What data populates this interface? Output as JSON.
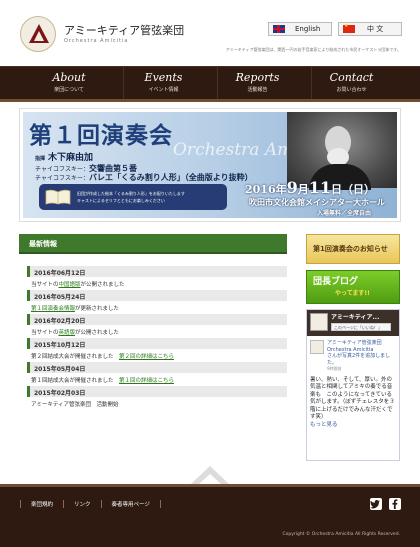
{
  "header": {
    "site_name": "アミーキティア管弦楽団",
    "site_sub": "Orchestra Amicitia",
    "tagline": "アミーキティア管弦楽団は、関西一円の若手音楽家により結成された市民オーケストラ団体です。",
    "lang_en": "English",
    "lang_zh": "中 文"
  },
  "nav": [
    {
      "en": "About",
      "ja": "楽団について"
    },
    {
      "en": "Events",
      "ja": "イベント情報"
    },
    {
      "en": "Reports",
      "ja": "活動報告"
    },
    {
      "en": "Contact",
      "ja": "お問い合わせ"
    }
  ],
  "hero": {
    "title": "第１回演奏会",
    "script": "Orchestra Amicitia",
    "conductor_role": "指揮",
    "conductor_name": "木下麻由加",
    "program1_composer": "チャイコフスキー：",
    "program1_work": "交響曲第５番",
    "program2_composer": "チャイコフスキー：",
    "program2_work": "バレエ「くるみ割り人形」（全曲版より抜粋）",
    "box_line1": "旧団が作成した絵本「くるみ割り人形」をお配りいたします",
    "box_line2": "キャストによるセリフとともにお楽しみください",
    "date_year": "2016年",
    "date_month": "9",
    "date_month_suffix": "月",
    "date_day": "11",
    "date_day_suffix": "日",
    "date_weekday": "（日）",
    "venue": "吹田市文化会館メイシアター大ホール",
    "admission": "入場無料／全席自由"
  },
  "news": {
    "heading": "最新情報",
    "items": [
      {
        "date": "2016年06月12日",
        "pre": "当サイトの",
        "link": "中国語版",
        "post": "が公開されました"
      },
      {
        "date": "2016年05月24日",
        "pre": "",
        "link": "第１回演奏会情報",
        "post": "が更新されました"
      },
      {
        "date": "2016年02月20日",
        "pre": "当サイトの",
        "link": "英語版",
        "post": "が公開されました"
      },
      {
        "date": "2015年10月12日",
        "pre": "第２回結成大会が開催されました　",
        "link": "第２回の詳細はこちら",
        "post": ""
      },
      {
        "date": "2015年05月04日",
        "pre": "第１回結成大会が開催されました　",
        "link": "第１回の詳細はこちら",
        "post": ""
      },
      {
        "date": "2015年02月03日",
        "pre": "アミーキティア管弦楽団　活動開始",
        "link": "",
        "post": ""
      }
    ]
  },
  "sidebar": {
    "banner1": "第1回演奏会のお知らせ",
    "banner2_title": "団長ブログ",
    "banner2_sub": "やってます!!",
    "fb_page_name": "アミーキティア...",
    "fb_like": "このページに「いいね！」",
    "fb_post_author": "アミーキティア管弦楽団 Orchestra Amicitia",
    "fb_post_action": "さんが写真2件を追加しました。",
    "fb_post_time": "9時間前",
    "fb_post_body": "暑い、熱い、そして、厚い。外の気温と相関してアミキの奏でる音楽も　このようになってきている気がします。（ぼずチェレスタを３階に上げるだけでみんな汗だくです笑）",
    "fb_post_more": "もっと見る"
  },
  "footer": {
    "links": [
      "楽団規約",
      "リンク",
      "奏者専用ページ"
    ],
    "copyright": "Copyright © Orchestra Amicitia All Rights Reserved."
  }
}
